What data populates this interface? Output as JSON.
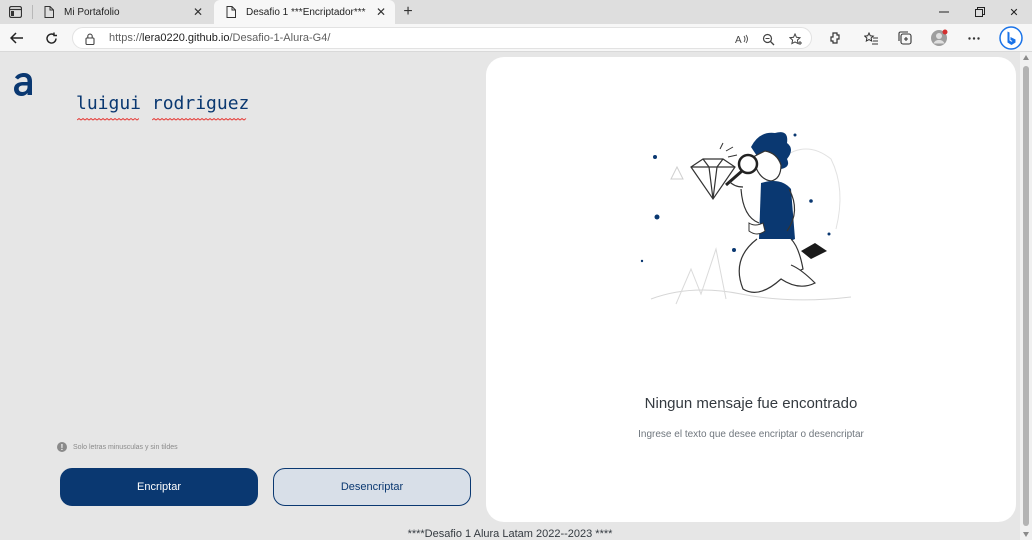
{
  "browser": {
    "tabs": [
      {
        "title": "Mi Portafolio",
        "active": false
      },
      {
        "title": "Desafio 1 ***Encriptador***",
        "active": true
      }
    ],
    "address": {
      "scheme": "https://",
      "host": "lera0220.github.io",
      "path": "/Desafio-1-Alura-G4/"
    },
    "accent": "#0a66c2"
  },
  "page": {
    "input_text": "luigui rodriguez",
    "hint": "Solo letras minusculas y sin tildes",
    "encrypt_label": "Encriptar",
    "decrypt_label": "Desencriptar",
    "empty_title": "Ningun mensaje fue encontrado",
    "empty_subtitle": "Ingrese el texto que desee encriptar o desencriptar",
    "footer": "****Desafio 1 Alura Latam 2022--2023 ****",
    "colors": {
      "primary": "#0a3871",
      "background": "#e6e6e6",
      "card": "#ffffff"
    }
  }
}
